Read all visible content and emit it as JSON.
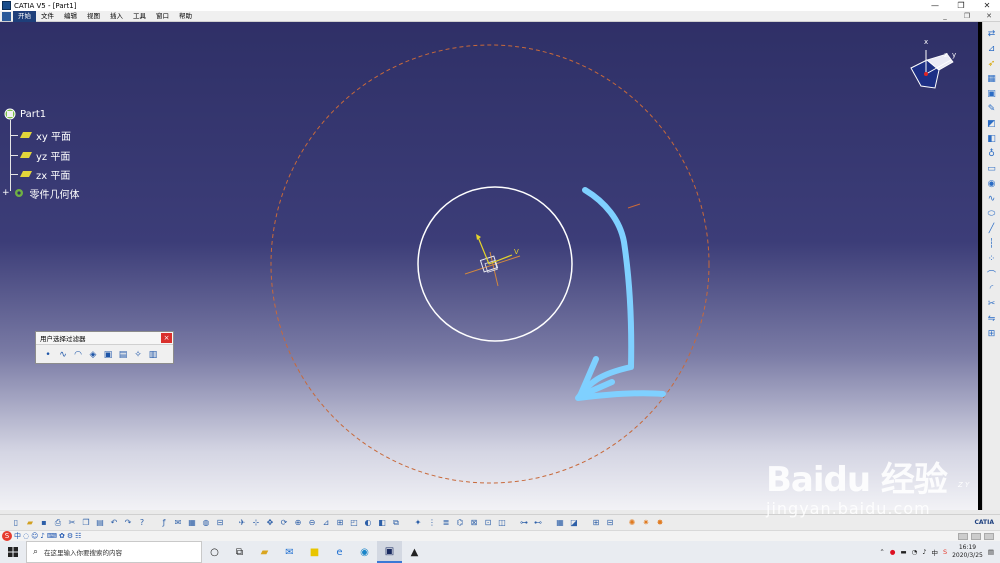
{
  "window": {
    "title": "CATIA V5 - [Part1]",
    "minimize": "—",
    "restore": "❐",
    "close": "✕"
  },
  "menu": {
    "items": [
      "开始",
      "文件",
      "编辑",
      "视图",
      "插入",
      "工具",
      "窗口",
      "帮助"
    ]
  },
  "tree": {
    "root": "Part1",
    "nodes": [
      {
        "label": "xy 平面"
      },
      {
        "label": "yz 平面"
      },
      {
        "label": "zx 平面"
      },
      {
        "label": "零件几何体"
      }
    ]
  },
  "compass": {
    "x": "x",
    "y": "y",
    "z": "z"
  },
  "sketch_axes": {
    "v": "V"
  },
  "filter_toolbar": {
    "title": "用户选择过滤器",
    "close": "×"
  },
  "corner_axis_label": "Z Y",
  "bottom_toolbar": {
    "logo": "CATIA"
  },
  "taskbar": {
    "search_placeholder": "在这里输入你要搜索的内容",
    "time": "16:19",
    "date": "2020/3/25",
    "ime": "中"
  },
  "watermark": {
    "brand": "Baidu 经验",
    "url": "jingyan.baidu.com"
  },
  "colors": {
    "viewport_top": "#2f3067",
    "circle": "#ffffff",
    "dashed_circle": "#c8693a",
    "annotation_arrow": "#7fd0ff",
    "taskbar": "#e9ecf1"
  }
}
